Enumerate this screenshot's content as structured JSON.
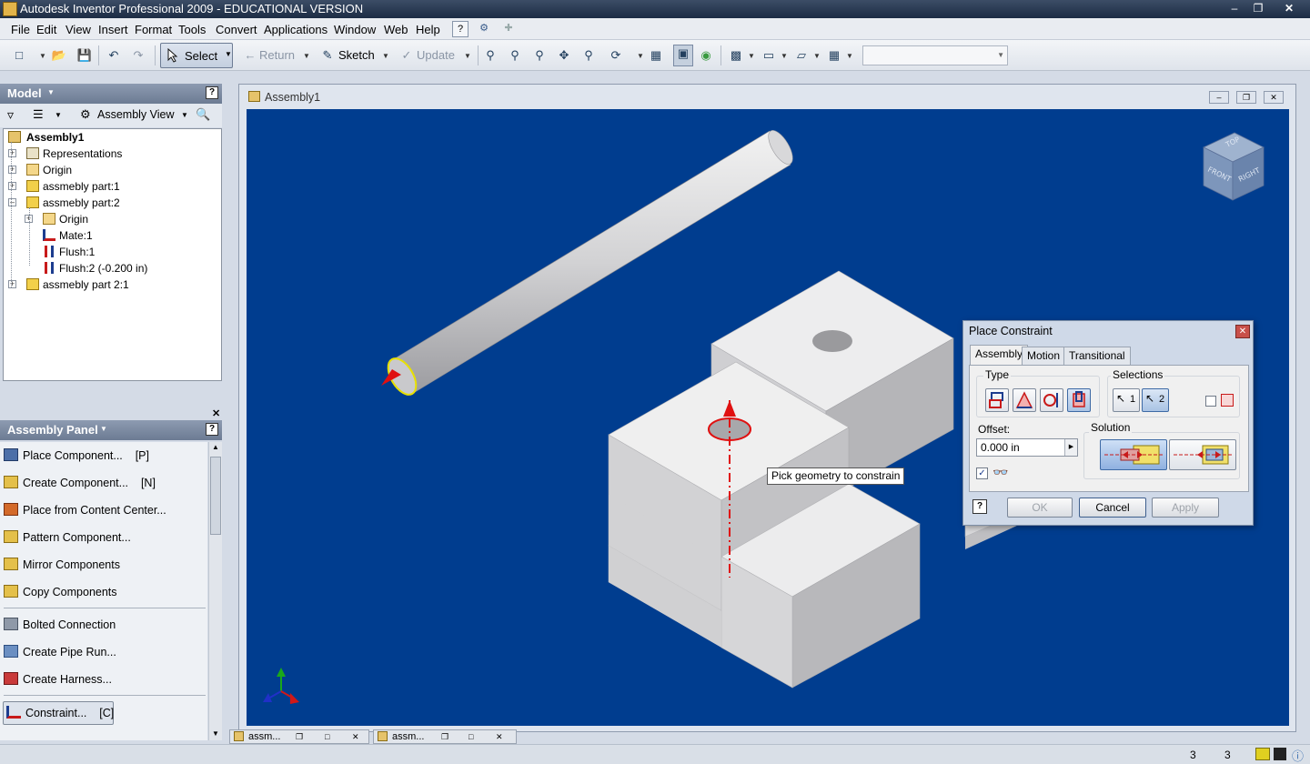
{
  "window": {
    "title": "Autodesk Inventor Professional 2009 - EDUCATIONAL VERSION"
  },
  "menu": [
    "File",
    "Edit",
    "View",
    "Insert",
    "Format",
    "Tools",
    "Convert",
    "Applications",
    "Window",
    "Web",
    "Help"
  ],
  "toolbar": {
    "select_label": "Select",
    "return_label": "Return",
    "sketch_label": "Sketch",
    "update_label": "Update"
  },
  "model_panel": {
    "title": "Model",
    "view_label": "Assembly View",
    "tree": [
      {
        "label": "Assembly1",
        "bold": true
      },
      {
        "label": "Representations"
      },
      {
        "label": "Origin"
      },
      {
        "label": "assmebly part:1"
      },
      {
        "label": "assmebly part:2"
      },
      {
        "label": "Origin"
      },
      {
        "label": "Mate:1"
      },
      {
        "label": "Flush:1"
      },
      {
        "label": "Flush:2 (-0.200 in)"
      },
      {
        "label": "assmebly part 2:1"
      }
    ]
  },
  "assembly_panel": {
    "title": "Assembly Panel",
    "items": [
      {
        "label": "Place Component...",
        "key": "[P]"
      },
      {
        "label": "Create Component...",
        "key": "[N]"
      },
      {
        "label": "Place from Content Center..."
      },
      {
        "label": "Pattern Component..."
      },
      {
        "label": "Mirror Components"
      },
      {
        "label": "Copy Components"
      },
      {
        "label": "Bolted Connection"
      },
      {
        "label": "Create Pipe Run..."
      },
      {
        "label": "Create Harness..."
      },
      {
        "label": "Constraint...",
        "key": "[C]"
      }
    ]
  },
  "document": {
    "title": "Assembly1",
    "tabs": [
      "assm...",
      "assm..."
    ]
  },
  "viewcube": {
    "faces": [
      "TOP",
      "FRONT",
      "RIGHT"
    ]
  },
  "tooltip": "Pick geometry to constrain",
  "dialog": {
    "title": "Place Constraint",
    "tabs": [
      "Assembly",
      "Motion",
      "Transitional"
    ],
    "type_label": "Type",
    "selections_label": "Selections",
    "sel1": "1",
    "sel2": "2",
    "offset_label": "Offset:",
    "offset_value": "0.000 in",
    "solution_label": "Solution",
    "ok": "OK",
    "cancel": "Cancel",
    "apply": "Apply",
    "help": "?"
  },
  "status": {
    "left_count": "3",
    "right_count": "3"
  }
}
